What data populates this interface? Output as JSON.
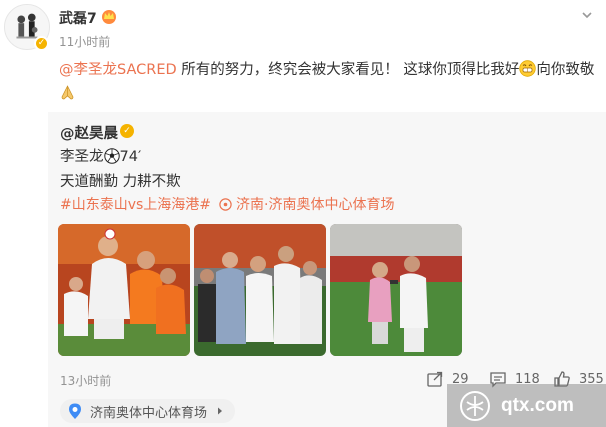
{
  "post": {
    "username": "武磊7",
    "time": "11小时前",
    "mention": "@李圣龙SACRED",
    "text_part1": " 所有的努力，终究会被大家看见！ 这球你顶得比我好",
    "text_part2": "向你致敬"
  },
  "repost": {
    "author": "@赵昊晨",
    "line1_name": "李圣龙",
    "line1_minute": "74′",
    "line2": "天道酬勤 力耕不欺",
    "hashtag": "#山东泰山vs上海海港#",
    "location_tag": "济南·济南奥体中心体育场",
    "time": "13小时前",
    "share_count": "29",
    "comment_count": "118",
    "like_count": "355",
    "location_pill": "济南奥体中心体育场"
  },
  "watermark": {
    "text": "qtx.com"
  },
  "colors": {
    "accent": "#eb7350",
    "verified": "#f5b300",
    "repost_bg": "#f7f7f7"
  },
  "icons": [
    "verified-icon",
    "crown-icon",
    "soccer-ball-icon",
    "location-icon",
    "share-icon",
    "comment-icon",
    "like-icon",
    "pin-icon",
    "chevron-right-icon",
    "grin-emoji",
    "pray-emoji"
  ]
}
